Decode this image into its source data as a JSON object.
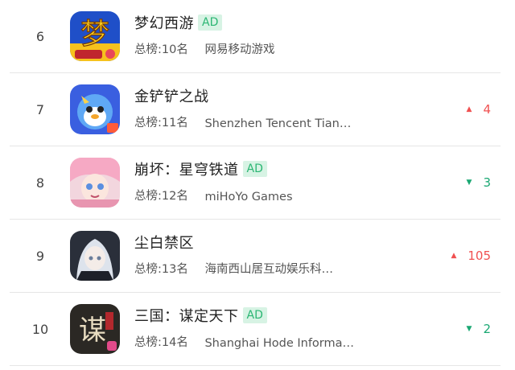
{
  "rows": [
    {
      "rank": "6",
      "name": "梦幻西游",
      "ad": "AD",
      "chart_rank": "总榜:10名",
      "publisher": "网易移动游戏",
      "change": "",
      "icon": "menghuan-xiyou-app-icon"
    },
    {
      "rank": "7",
      "name": "金铲铲之战",
      "ad": "",
      "chart_rank": "总榜:11名",
      "publisher": "Shenzhen Tencent Tian…",
      "change": "4",
      "direction": "up",
      "icon": "jinchanchan-app-icon"
    },
    {
      "rank": "8",
      "name": "崩坏：星穹铁道",
      "ad": "AD",
      "chart_rank": "总榜:12名",
      "publisher": "miHoYo Games",
      "change": "3",
      "direction": "down",
      "icon": "honkai-star-rail-app-icon"
    },
    {
      "rank": "9",
      "name": "尘白禁区",
      "ad": "",
      "chart_rank": "总榜:13名",
      "publisher": "海南西山居互动娱乐科…",
      "change": "105",
      "direction": "up",
      "icon": "chenbai-jinqu-app-icon"
    },
    {
      "rank": "10",
      "name": "三国：谋定天下",
      "ad": "AD",
      "chart_rank": "总榜:14名",
      "publisher": "Shanghai Hode Informa…",
      "change": "2",
      "direction": "down",
      "icon": "sanguo-mouding-app-icon"
    }
  ],
  "arrows": {
    "up": "▲",
    "down": "▼"
  },
  "colors": {
    "ad_bg": "#d7f3e4",
    "ad_text": "#2bb673",
    "up": "#f05050",
    "down": "#1aa873",
    "divider": "#e6e6e6"
  }
}
